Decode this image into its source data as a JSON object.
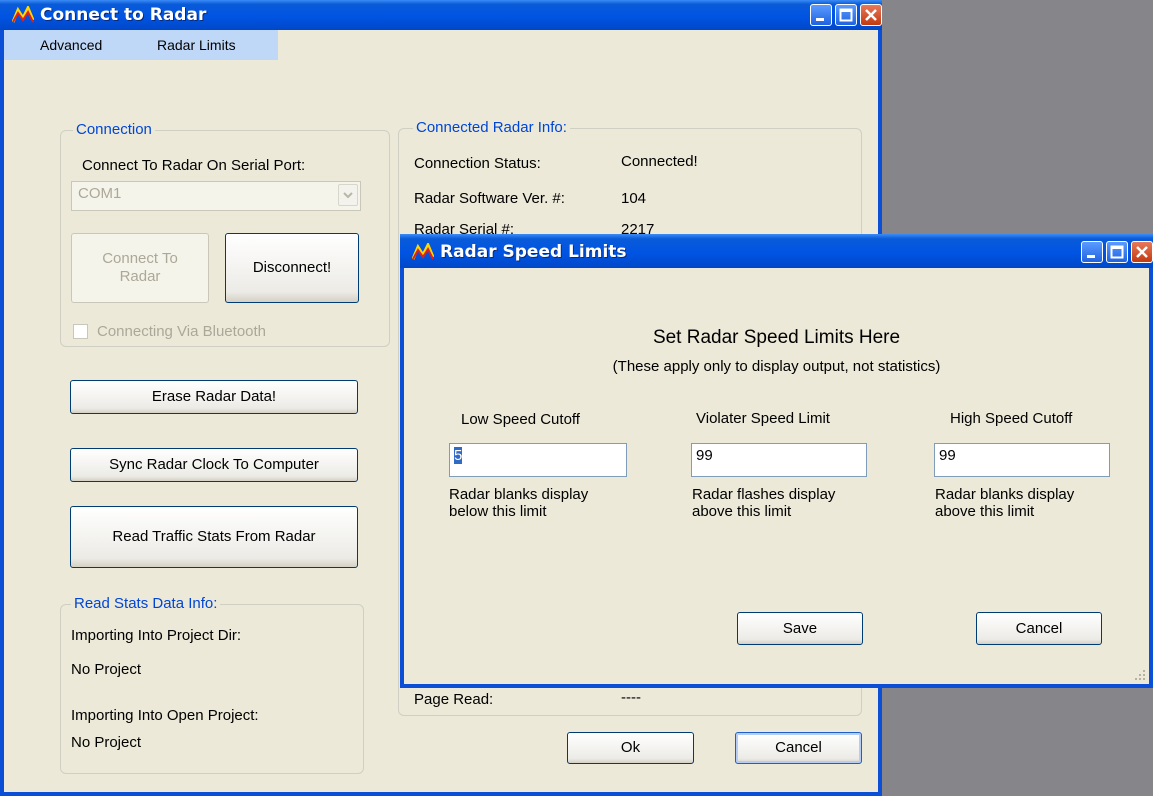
{
  "main_window": {
    "title": "Connect to Radar",
    "menu": [
      "Advanced",
      "Radar Limits"
    ],
    "connection": {
      "legend": "Connection",
      "port_label": "Connect To Radar On Serial Port:",
      "port_value": "COM1",
      "connect_button_line1": "Connect To",
      "connect_button_line2": "Radar",
      "disconnect_button": "Disconnect!",
      "bluetooth_label": "Connecting Via Bluetooth"
    },
    "buttons": {
      "erase": "Erase Radar Data!",
      "sync": "Sync Radar Clock To Computer",
      "read": "Read Traffic Stats From Radar",
      "ok": "Ok",
      "cancel": "Cancel"
    },
    "radar_info": {
      "legend": "Connected Radar Info:",
      "status_label": "Connection Status:",
      "status_value": "Connected!",
      "software_label": "Radar Software Ver. #:",
      "software_value": "104",
      "serial_label": "Radar Serial #:",
      "serial_value": "2217",
      "page_read_label": "Page Read:",
      "page_read_value": "----"
    },
    "read_stats": {
      "legend": "Read Stats Data Info:",
      "project_dir_label": "Importing Into Project Dir:",
      "project_dir_value": "No Project",
      "open_project_label": "Importing Into Open Project:",
      "open_project_value": "No Project"
    }
  },
  "dialog": {
    "title": "Radar Speed Limits",
    "heading": "Set Radar Speed Limits Here",
    "subheading": "(These apply only to display output, not statistics)",
    "low": {
      "label": "Low Speed Cutoff",
      "value": "5",
      "desc1": "Radar blanks display",
      "desc2": "below this limit"
    },
    "violater": {
      "label": "Violater Speed Limit",
      "value": "99",
      "desc1": "Radar flashes display",
      "desc2": "above this limit"
    },
    "high": {
      "label": "High Speed Cutoff",
      "value": "99",
      "desc1": "Radar blanks display",
      "desc2": "above this limit"
    },
    "save_button": "Save",
    "cancel_button": "Cancel"
  },
  "colors": {
    "titlebar": "#0054E3",
    "window_bg": "#ECE9D8",
    "group_legend": "#0046D5",
    "desktop": "#868589"
  },
  "icons": [
    "app-icon",
    "minimize-icon",
    "maximize-icon",
    "close-icon",
    "dropdown-arrow-icon",
    "resize-grip-icon"
  ]
}
